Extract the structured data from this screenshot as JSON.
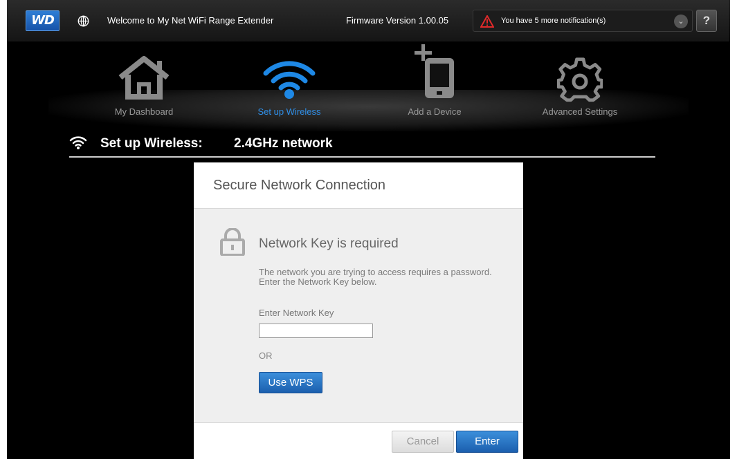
{
  "topbar": {
    "logo_text": "WD",
    "welcome": "Welcome to My Net WiFi Range Extender",
    "firmware": "Firmware Version 1.00.05",
    "notification": "You have 5 more notification(s)",
    "help_label": "?",
    "icons": {
      "globe": "globe-icon",
      "warning": "warning-icon",
      "chevron": "chevron-down-icon"
    },
    "colors": {
      "warning": "#e02a2a",
      "brand": "#1f6cc4"
    }
  },
  "nav": {
    "items": [
      {
        "label": "My Dashboard",
        "icon": "home-icon",
        "active": false
      },
      {
        "label": "Set up Wireless",
        "icon": "wifi-icon",
        "active": true
      },
      {
        "label": "Add a Device",
        "icon": "add-device-icon",
        "active": false
      },
      {
        "label": "Advanced Settings",
        "icon": "gear-icon",
        "active": false
      }
    ],
    "active_color": "#2f8fe8"
  },
  "page": {
    "heading": "Set up Wireless:",
    "subheading": "2.4GHz network"
  },
  "dialog": {
    "title": "Secure Network Connection",
    "key_required": "Network Key is required",
    "description": "The network you are trying to access requires a password. Enter the Network Key below.",
    "key_label": "Enter Network Key",
    "key_value": "",
    "or_text": "OR",
    "wps_label": "Use WPS",
    "cancel_label": "Cancel",
    "enter_label": "Enter"
  }
}
